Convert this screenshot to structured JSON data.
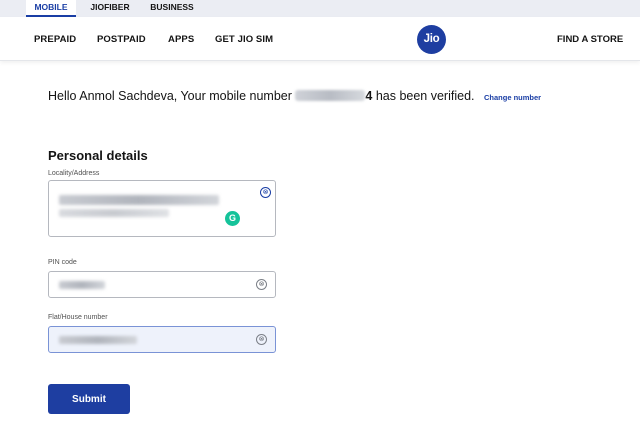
{
  "segments": [
    {
      "label": "MOBILE",
      "active": true
    },
    {
      "label": "JIOFIBER",
      "active": false
    },
    {
      "label": "BUSINESS",
      "active": false
    }
  ],
  "nav": {
    "items": [
      "PREPAID",
      "POSTPAID",
      "APPS",
      "GET JIO SIM"
    ],
    "find_store": "FIND A STORE"
  },
  "brand": {
    "logo_text": "Jio",
    "color": "#1e3ea1"
  },
  "greeting": {
    "prefix": "Hello Anmol Sachdeva, Your mobile number",
    "number_tail": "4",
    "suffix": "has been verified.",
    "change_link": "Change number"
  },
  "form": {
    "title": "Personal details",
    "fields": [
      {
        "label": "Locality/Address",
        "value_redacted": true
      },
      {
        "label": "PIN code",
        "value_redacted": true
      },
      {
        "label": "Flat/House number",
        "value_redacted": true
      }
    ],
    "submit_label": "Submit"
  },
  "icons": {
    "clear": "⊗",
    "grammarly": "G"
  },
  "colors": {
    "accent": "#1a3ea5",
    "button": "#1e3ea1",
    "grammarly": "#15c39a",
    "topbar": "#ebedf3"
  }
}
